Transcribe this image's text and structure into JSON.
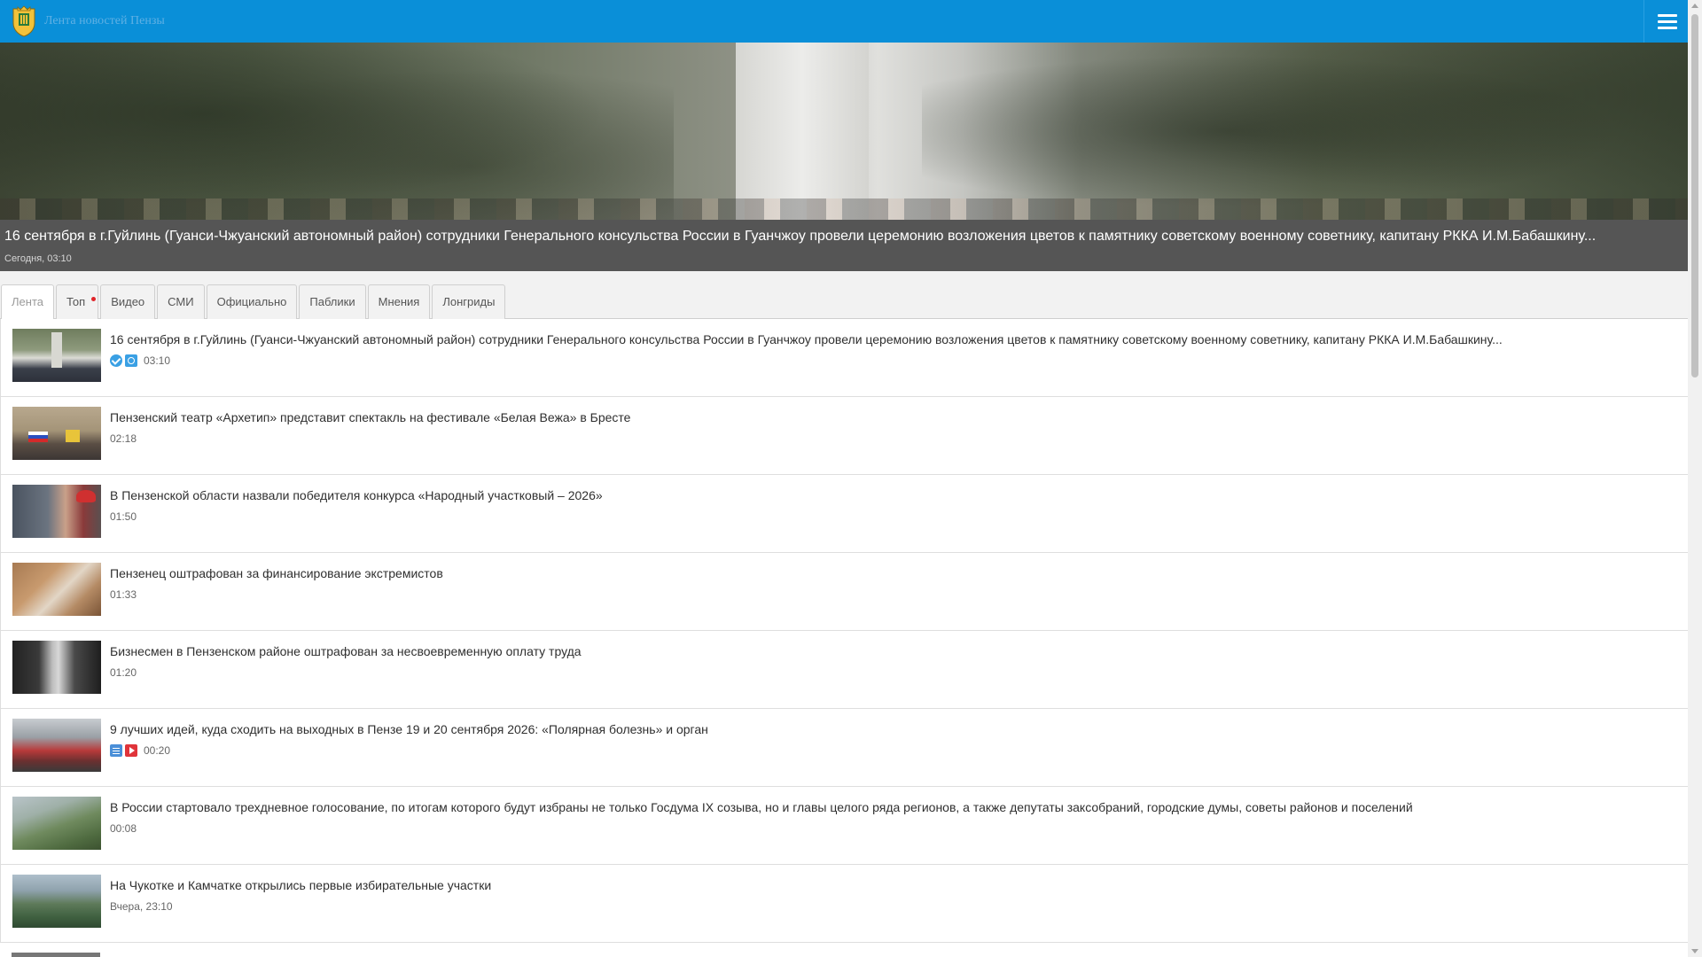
{
  "header": {
    "site_title": "Лента новостей Пензы",
    "logo_icon": "penza-coat-of-arms-icon",
    "menu_icon": "hamburger-menu-icon",
    "bar_color": "#0a8fd8"
  },
  "hero": {
    "title": "16 сентября в г.Гуйлинь (Гуанси-Чжуанский автономный район) сотрудники Генерального консульства России в Гуанчжоу провели церемонию возложения цветов к памятнику советскому военному советнику, капитану РККА И.М.Бабашкину...",
    "time": "Сегодня, 03:10"
  },
  "tabs": [
    {
      "label": "Лента",
      "active": true
    },
    {
      "label": "Топ",
      "active": false,
      "dot": true
    },
    {
      "label": "Видео",
      "active": false
    },
    {
      "label": "СМИ",
      "active": false
    },
    {
      "label": "Официально",
      "active": false
    },
    {
      "label": "Паблики",
      "active": false
    },
    {
      "label": "Мнения",
      "active": false
    },
    {
      "label": "Лонгриды",
      "active": false
    }
  ],
  "feed": [
    {
      "title": "16 сентября в г.Гуйлинь (Гуанси-Чжуанский автономный район) сотрудники Генерального консульства России в Гуанчжоу провели церемонию возложения цветов к памятнику советскому военному советнику, капитану РККА И.М.Бабашкину...",
      "time": "03:10",
      "badges": [
        "verified-icon",
        "photo-icon"
      ]
    },
    {
      "title": "Пензенский театр «Архетип» представит спектакль на фестивале «Белая Вежа» в Бресте",
      "time": "02:18",
      "badges": []
    },
    {
      "title": "В Пензенской области назвали победителя конкурса «Народный участковый – 2026»",
      "time": "01:50",
      "badges": []
    },
    {
      "title": "Пензенец оштрафован за финансирование экстремистов",
      "time": "01:33",
      "badges": []
    },
    {
      "title": "Бизнесмен в Пензенском районе оштрафован за несвоевременную оплату труда",
      "time": "01:20",
      "badges": []
    },
    {
      "title": "9 лучших идей, куда сходить на выходных в Пензе 19 и 20 сентября 2026: «Полярная болезнь» и орган",
      "time": "00:20",
      "badges": [
        "article-icon",
        "video-icon"
      ]
    },
    {
      "title": "В России стартовало трехдневное голосование, по итогам которого будут избраны не только Госдума IX созыва, но и главы целого ряда регионов, а также депутаты заксобраний, городские думы, советы районов и поселений",
      "time": "00:08",
      "badges": []
    },
    {
      "title": "На Чукотке и Камчатке открылись первые избирательные участки",
      "time": "Вчера, 23:10",
      "badges": []
    }
  ]
}
